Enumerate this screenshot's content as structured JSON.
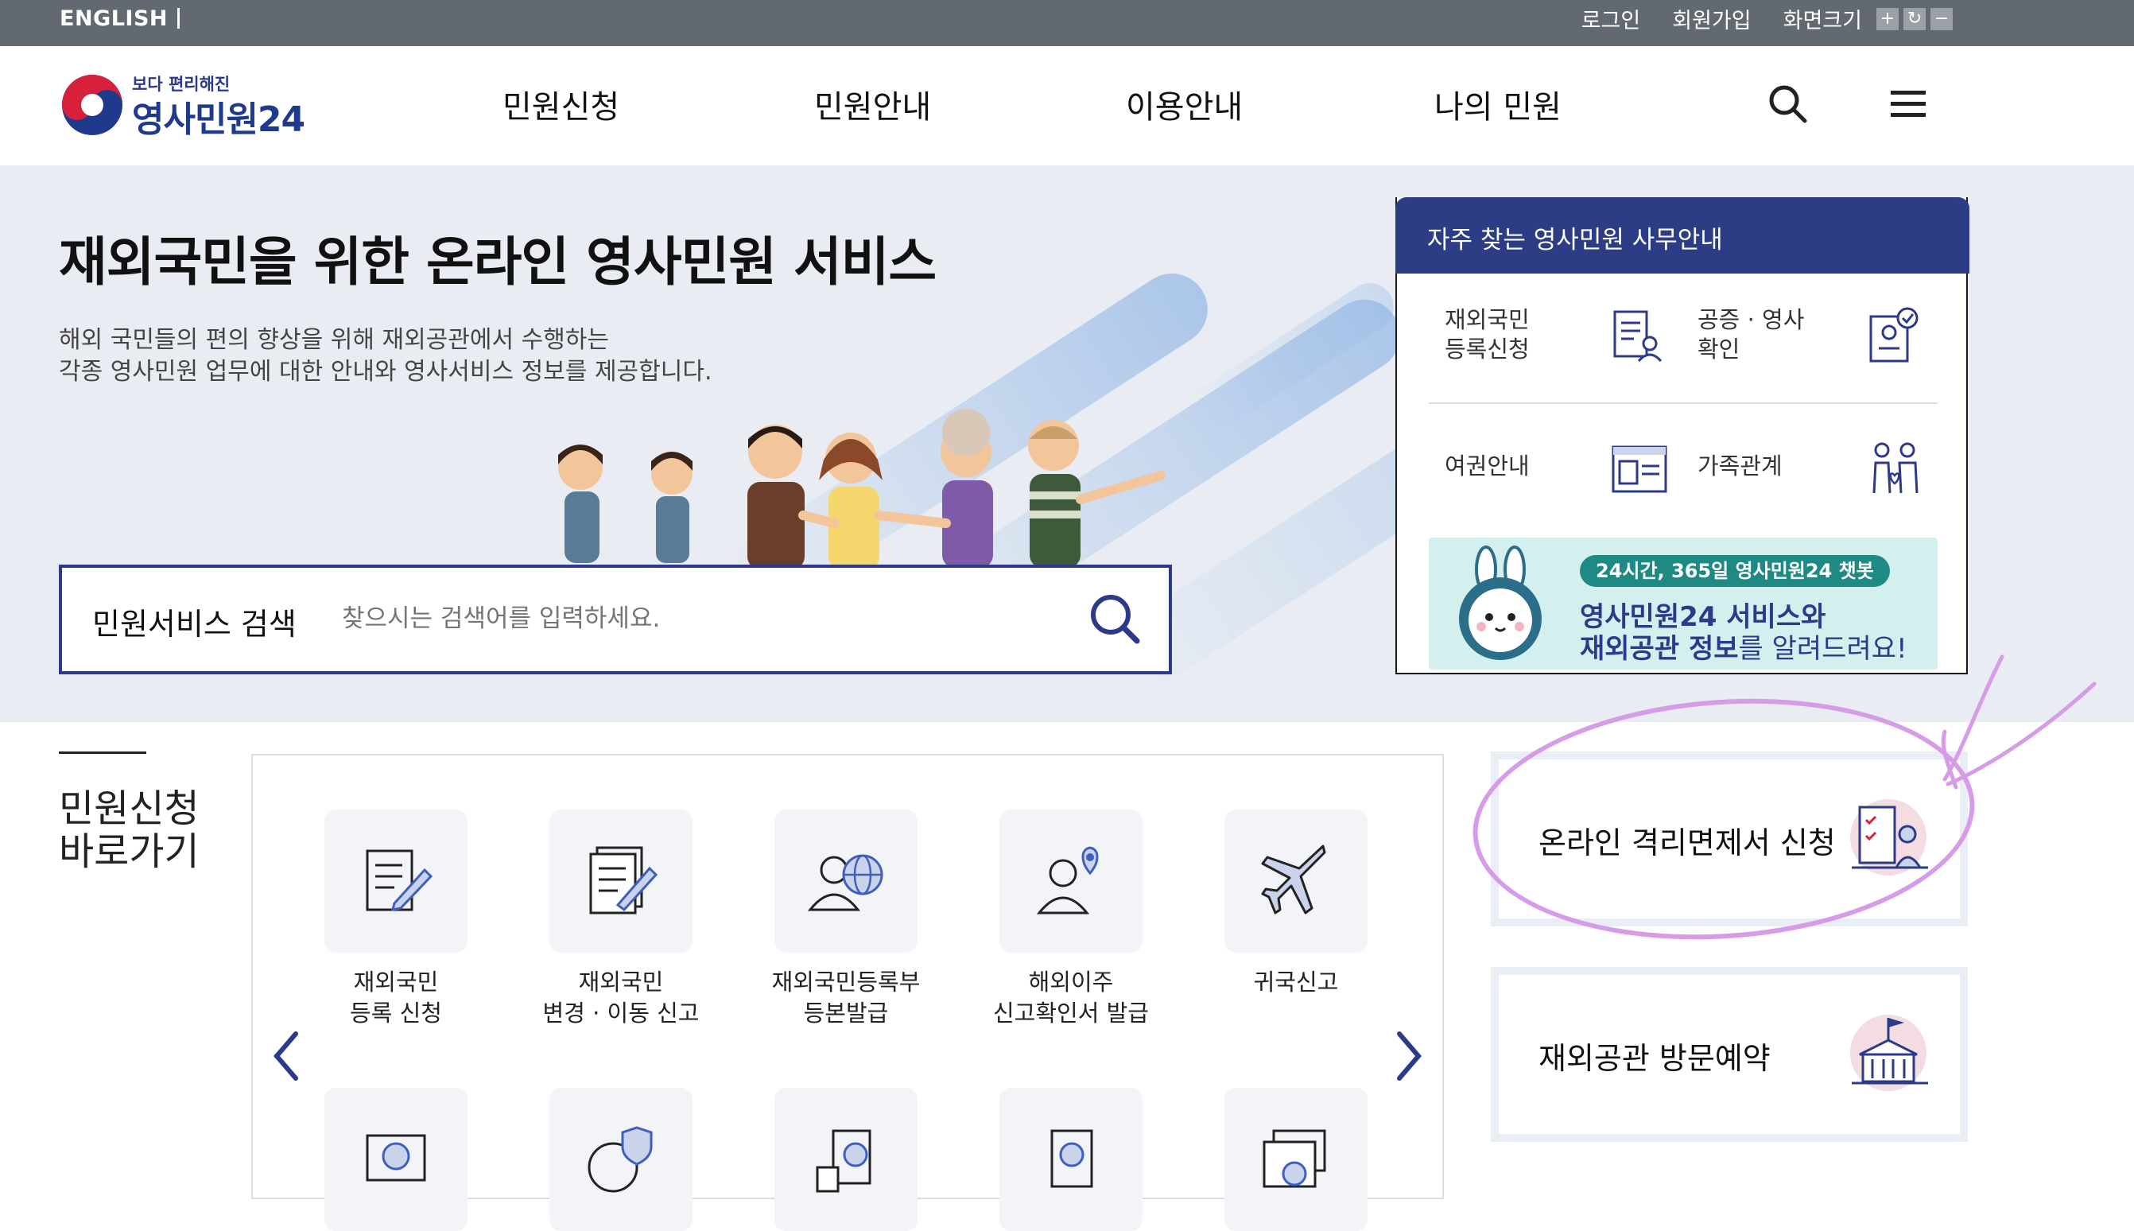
{
  "topbar": {
    "english": "ENGLISH",
    "login": "로그인",
    "signup": "회원가입",
    "screen_size": "화면크기",
    "zoom_in": "+",
    "zoom_reset": "↻",
    "zoom_out": "−"
  },
  "logo": {
    "tagline": "보다 편리해진",
    "name": "영사민원24"
  },
  "nav": [
    "민원신청",
    "민원안내",
    "이용안내",
    "나의 민원"
  ],
  "hero": {
    "title": "재외국민을 위한 온라인 영사민원 서비스",
    "desc_line1": "해외 국민들의 편의 향상을 위해 재외공관에서 수행하는",
    "desc_line2": "각종 영사민원 업무에 대한 안내와 영사서비스 정보를 제공합니다."
  },
  "search": {
    "label": "민원서비스 검색",
    "placeholder": "찾으시는 검색어를 입력하세요."
  },
  "faq": {
    "title": "자주 찾는 영사민원 사무안내",
    "items": [
      {
        "line1": "재외국민",
        "line2": "등록신청",
        "icon": "document-person-icon"
      },
      {
        "line1": "공증 · 영사",
        "line2": "확인",
        "icon": "certificate-check-icon"
      },
      {
        "line1": "여권안내",
        "line2": "",
        "icon": "passport-icon"
      },
      {
        "line1": "가족관계",
        "line2": "",
        "icon": "family-icon"
      }
    ],
    "chatbot": {
      "pill": "24시간, 365일 영사민원24 챗봇",
      "line1": "영사민원24 서비스와",
      "line2_bold": "재외공관 정보",
      "line2_rest": "를 알려드려요!"
    }
  },
  "quick": {
    "title_line1": "민원신청",
    "title_line2": "바로가기",
    "items": [
      {
        "line1": "재외국민",
        "line2": "등록 신청",
        "icon": "document-pen-icon"
      },
      {
        "line1": "재외국민",
        "line2": "변경 · 이동 신고",
        "icon": "document-edit-icon"
      },
      {
        "line1": "재외국민등록부",
        "line2": "등본발급",
        "icon": "person-globe-icon"
      },
      {
        "line1": "해외이주",
        "line2": "신고확인서 발급",
        "icon": "person-location-icon"
      },
      {
        "line1": "귀국신고",
        "line2": "",
        "icon": "airplane-icon"
      }
    ]
  },
  "promos": [
    {
      "label": "온라인 격리면제서 신청",
      "icon": "checklist-person-icon"
    },
    {
      "label": "재외공관 방문예약",
      "icon": "embassy-building-icon"
    }
  ],
  "colors": {
    "brand": "#2c3d86",
    "topbar": "#636970",
    "hero_bg": "#e9edf3",
    "highlight": "#d69ce8"
  }
}
